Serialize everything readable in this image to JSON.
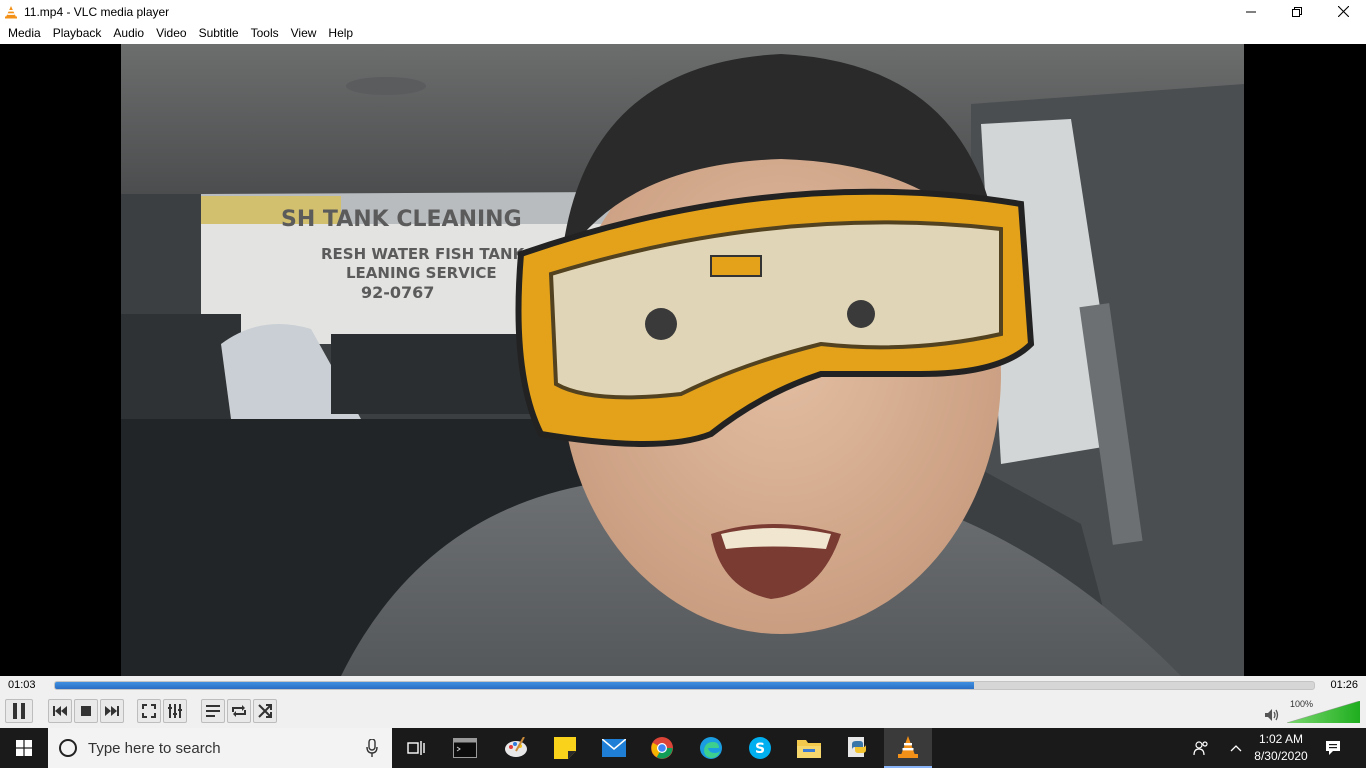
{
  "window": {
    "title": "11.mp4 - VLC media player",
    "app_icon": "vlc-cone-icon"
  },
  "menubar": {
    "items": [
      "Media",
      "Playback",
      "Audio",
      "Video",
      "Subtitle",
      "Tools",
      "View",
      "Help"
    ]
  },
  "video": {
    "sign_line1": "SH TANK CLEANING",
    "sign_line2": "RESH WATER FISH TANK",
    "sign_line3": "LEANING SERVICE",
    "sign_line4": "92-0767"
  },
  "playback": {
    "elapsed": "01:03",
    "total": "01:26",
    "progress": 0.73
  },
  "controls": {
    "buttons": [
      "pause-icon",
      "previous-icon",
      "stop-icon",
      "next-icon",
      "fullscreen-icon",
      "extended-settings-icon",
      "playlist-icon",
      "loop-icon",
      "shuffle-icon"
    ],
    "volume_percent": "100%",
    "volume_level": 1.0
  },
  "taskbar": {
    "search_placeholder": "Type here to search",
    "apps": [
      "task-view-icon",
      "terminal-icon",
      "paint-icon",
      "sticky-notes-icon",
      "mail-icon",
      "chrome-icon",
      "edge-icon",
      "skype-icon",
      "file-explorer-icon",
      "python-icon",
      "vlc-icon"
    ],
    "clock_time": "1:02 AM",
    "clock_date": "8/30/2020"
  },
  "colors": {
    "seek_fill": "#2a6fc4",
    "volume_fill": "#35c235",
    "taskbar_bg": "#1a1a1a"
  }
}
